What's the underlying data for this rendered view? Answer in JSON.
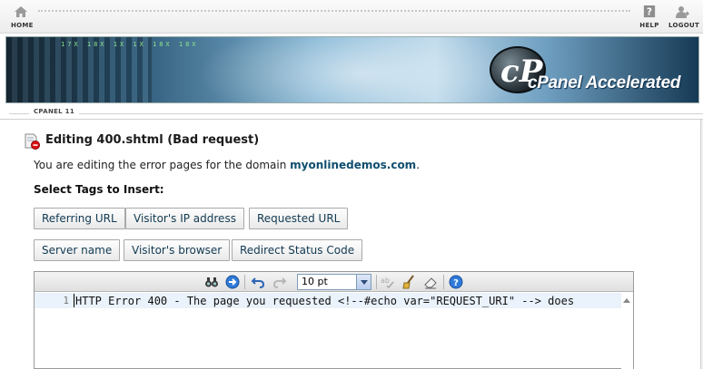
{
  "topnav": {
    "home_label": "HOME",
    "help_label": "HELP",
    "logout_label": "LOGOUT"
  },
  "banner": {
    "logo_glyph": "cP",
    "brand_text": "cPanel Accelerated",
    "ticker_text": "17X 18X 1X 1X 18X 18X"
  },
  "version_label": "CPANEL 11",
  "page": {
    "title": "Editing 400.shtml (Bad request)",
    "desc_prefix": "You are editing the error pages for the domain ",
    "domain": "myonlinedemos.com",
    "desc_suffix": ".",
    "select_tags_label": "Select Tags to Insert:"
  },
  "tags_row1": [
    "Referring URL",
    "Visitor's IP address",
    "Requested URL"
  ],
  "tags_row2": [
    "Server name",
    "Visitor's browser",
    "Redirect Status Code"
  ],
  "editor": {
    "font_size": "10 pt",
    "line_number": "1",
    "code_line": "HTTP Error 400 - The page you requested <!--#echo var=\"REQUEST_URI\" --> does"
  },
  "colors": {
    "link": "#104e6e",
    "button_text": "#123a52",
    "editor_highlight": "#eaf2fb"
  },
  "icons": [
    "home-icon",
    "help-icon",
    "logout-icon",
    "file-error-icon",
    "find-icon",
    "goto-icon",
    "undo-icon",
    "redo-icon",
    "spellcheck-icon",
    "clean-icon",
    "eraser-icon",
    "help-circle-icon"
  ]
}
